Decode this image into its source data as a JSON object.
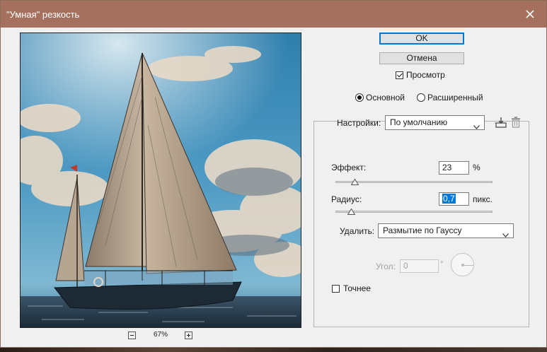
{
  "window": {
    "title": "\"Умная\" резкость",
    "close_icon": "close-icon"
  },
  "preview": {
    "image": "sailboat-at-sea",
    "zoom": "67%",
    "zoom_out_icon": "minus-icon",
    "zoom_in_icon": "plus-icon"
  },
  "buttons": {
    "ok": "OK",
    "cancel": "Отмена"
  },
  "preview_toggle": {
    "label": "Просмотр",
    "checked": true
  },
  "mode": {
    "basic": "Основной",
    "advanced": "Расширенный",
    "selected": "basic"
  },
  "settings": {
    "label": "Настройки:",
    "value": "По умолчанию",
    "save_icon": "save-preset-icon",
    "delete_icon": "trash-icon"
  },
  "amount": {
    "label": "Эффект:",
    "value": "23",
    "unit": "%",
    "slider_fraction": 0.06
  },
  "radius": {
    "label": "Радиус:",
    "value": "0,7",
    "unit": "пикс.",
    "slider_fraction": 0.04
  },
  "remove": {
    "label": "Удалить:",
    "value": "Размытие по Гауссу"
  },
  "angle": {
    "label": "Угол:",
    "value": "0",
    "unit": "°",
    "enabled": false
  },
  "more_accurate": {
    "label": "Точнее",
    "checked": false
  },
  "colors": {
    "titlebar": "#a6705e",
    "accent": "#0078d7"
  }
}
